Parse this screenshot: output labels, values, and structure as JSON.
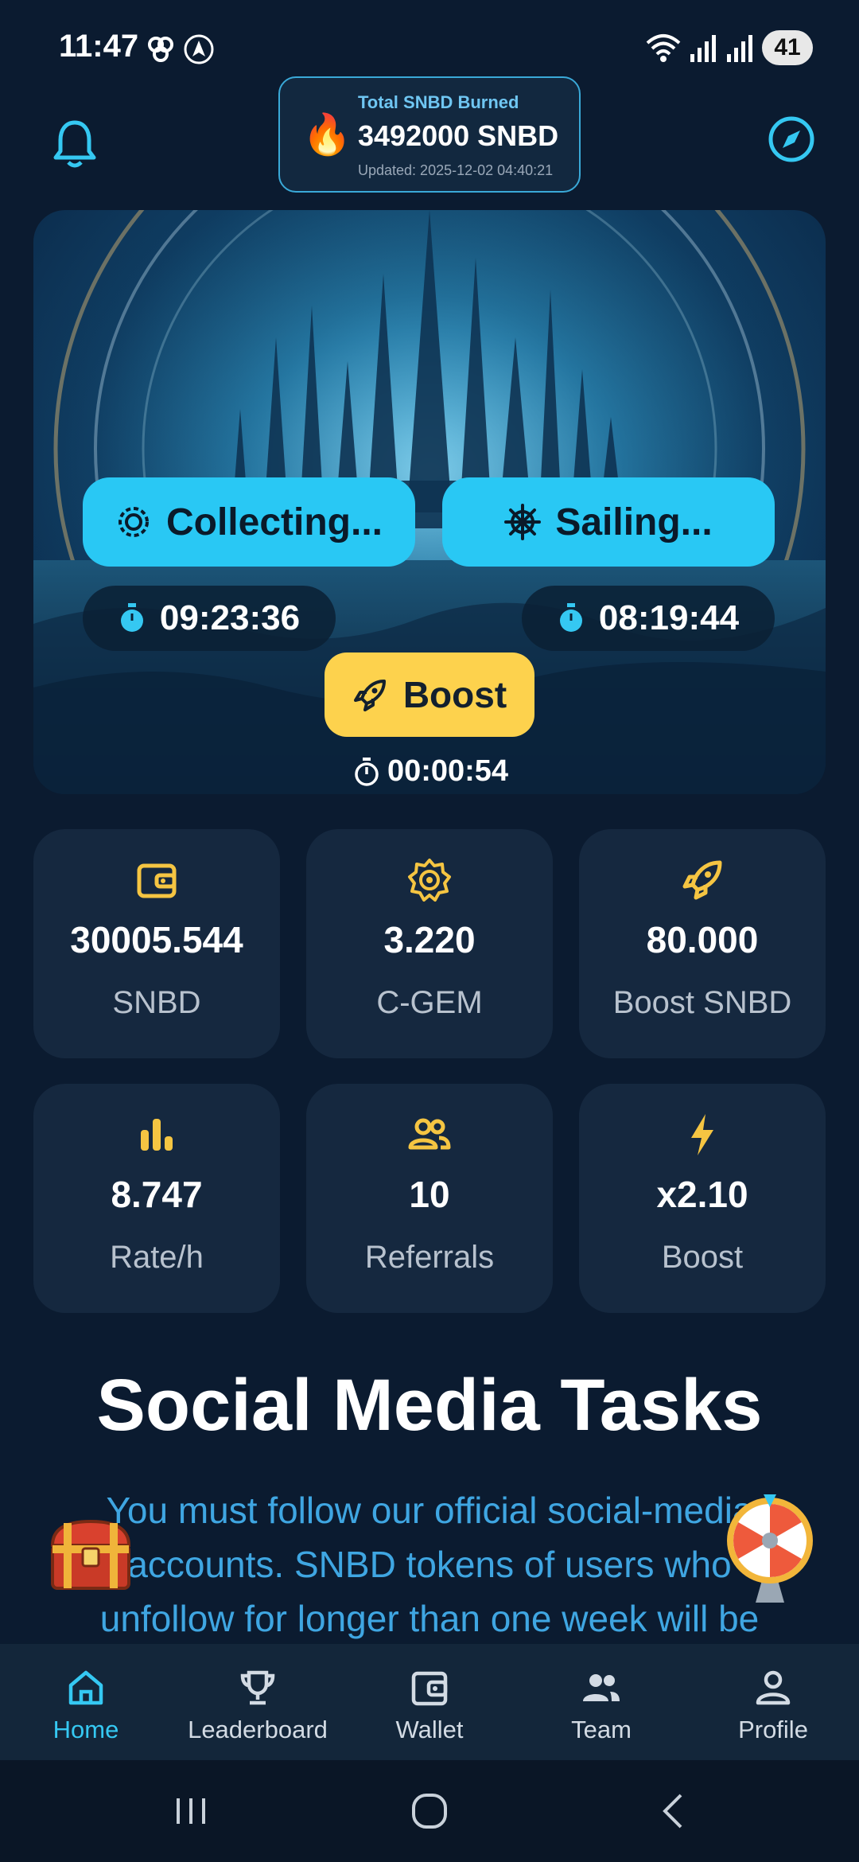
{
  "status_bar": {
    "time": "11:47",
    "battery": "41"
  },
  "header": {
    "burn_title": "Total SNBD Burned",
    "burn_value": "3492000 SNBD",
    "burn_updated": "Updated: 2025-12-02 04:40:21"
  },
  "hero": {
    "collect_label": "Collecting...",
    "sail_label": "Sailing...",
    "collect_timer": "09:23:36",
    "sail_timer": "08:19:44",
    "boost_label": "Boost",
    "boost_timer": "00:00:54"
  },
  "stats": [
    {
      "value": "30005.544",
      "label": "SNBD",
      "icon": "wallet-icon"
    },
    {
      "value": "3.220",
      "label": "C-GEM",
      "icon": "gem-gear-icon"
    },
    {
      "value": "80.000",
      "label": "Boost SNBD",
      "icon": "rocket-icon"
    },
    {
      "value": "8.747",
      "label": "Rate/h",
      "icon": "bar-chart-icon"
    },
    {
      "value": "10",
      "label": "Referrals",
      "icon": "people-icon"
    },
    {
      "value": "x2.10",
      "label": "Boost",
      "icon": "lightning-icon"
    }
  ],
  "social": {
    "title": "Social Media Tasks",
    "text": "You must follow our official social-media accounts. SNBD tokens of users who unfollow for longer than one week will be"
  },
  "nav": [
    {
      "label": "Home",
      "icon": "home-icon",
      "active": true
    },
    {
      "label": "Leaderboard",
      "icon": "trophy-icon",
      "active": false
    },
    {
      "label": "Wallet",
      "icon": "wallet-icon",
      "active": false
    },
    {
      "label": "Team",
      "icon": "team-icon",
      "active": false
    },
    {
      "label": "Profile",
      "icon": "profile-icon",
      "active": false
    }
  ],
  "colors": {
    "background": "#0b1b30",
    "accent": "#29c8f4",
    "boost": "#fdd24d",
    "card": "#15283f",
    "icon_yellow": "#f5c542"
  }
}
